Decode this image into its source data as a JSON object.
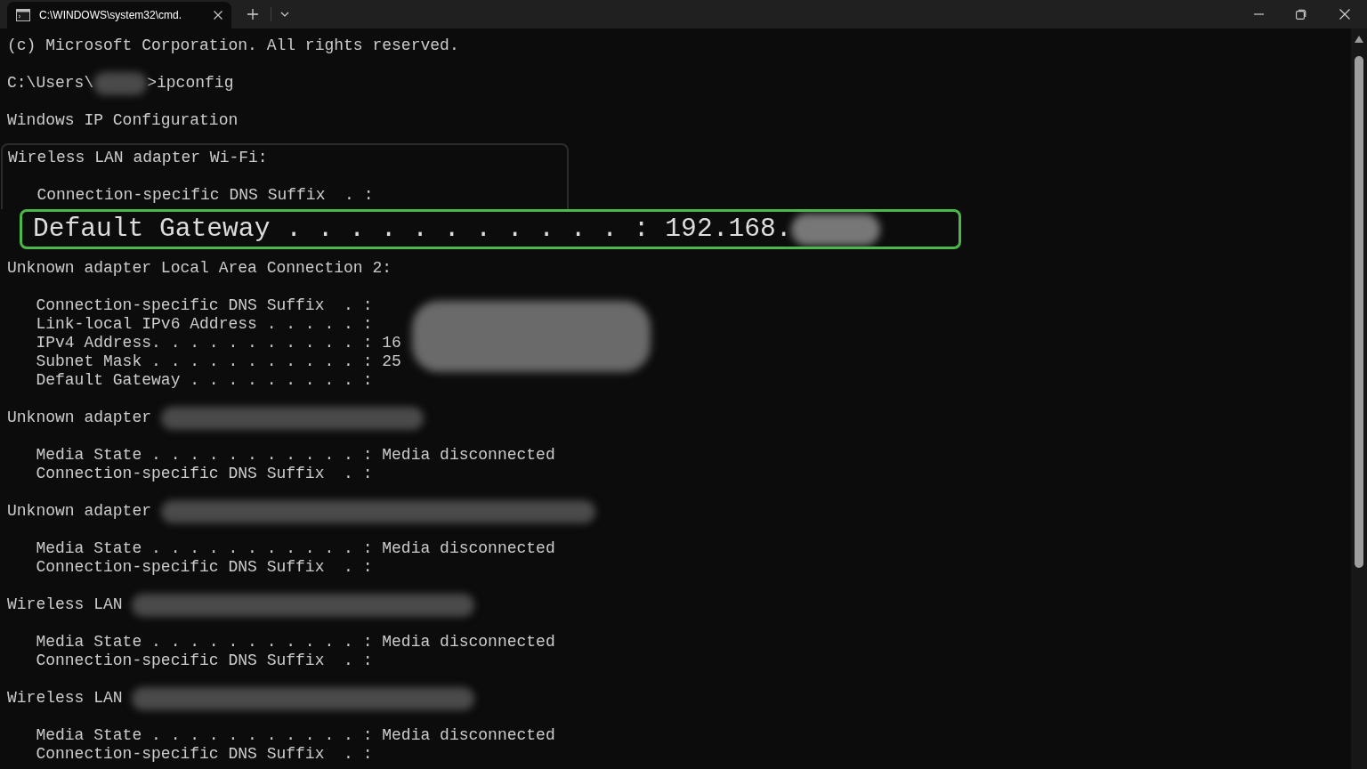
{
  "tabs": [
    {
      "label": "C:\\WINDOWS\\system32\\cmd.",
      "selected": true
    }
  ],
  "console": {
    "intro": [
      {
        "kind": "text",
        "parts": [
          {
            "kind": "text",
            "text": "(c) Microsoft Corporation. All rights reserved."
          }
        ]
      },
      {
        "kind": "blank"
      },
      {
        "kind": "text",
        "parts": [
          {
            "kind": "text",
            "text": "C:\\Users\\"
          },
          {
            "kind": "tinyblur"
          },
          {
            "kind": "text",
            "text": ">ipconfig"
          }
        ]
      },
      {
        "kind": "blank"
      },
      {
        "kind": "text",
        "parts": [
          {
            "kind": "text",
            "text": "Windows IP Configuration"
          }
        ]
      }
    ],
    "framed": [
      {
        "kind": "text",
        "parts": [
          {
            "kind": "text",
            "text": "Wireless LAN adapter Wi-Fi:"
          }
        ]
      },
      {
        "kind": "blank"
      },
      {
        "kind": "text",
        "parts": [
          {
            "kind": "text",
            "text": "   Connection-specific DNS Suffix  . :"
          }
        ]
      }
    ],
    "callout": {
      "parts": [
        {
          "kind": "text",
          "text": "Default Gateway . . . . . . . . . . . : 192.168."
        },
        {
          "kind": "smallblur"
        }
      ]
    },
    "lines": [
      {
        "kind": "text",
        "parts": [
          {
            "kind": "text",
            "text": "Unknown adapter Local Area Connection 2:"
          }
        ]
      },
      {
        "kind": "blank"
      },
      {
        "kind": "text",
        "parts": [
          {
            "kind": "text",
            "text": "   Connection-specific DNS Suffix  . : "
          },
          {
            "kind": "blockblur"
          }
        ]
      },
      {
        "kind": "text",
        "parts": [
          {
            "kind": "text",
            "text": "   Link-local IPv6 Address . . . . . :"
          }
        ]
      },
      {
        "kind": "text",
        "parts": [
          {
            "kind": "text",
            "text": "   IPv4 Address. . . . . . . . . . . : 16"
          }
        ]
      },
      {
        "kind": "text",
        "parts": [
          {
            "kind": "text",
            "text": "   Subnet Mask . . . . . . . . . . . : 25"
          }
        ]
      },
      {
        "kind": "text",
        "parts": [
          {
            "kind": "text",
            "text": "   Default Gateway . . . . . . . . . :"
          }
        ]
      },
      {
        "kind": "blank"
      },
      {
        "kind": "text",
        "parts": [
          {
            "kind": "text",
            "text": "Unknown adapter "
          },
          {
            "kind": "midblur"
          }
        ]
      },
      {
        "kind": "blank"
      },
      {
        "kind": "text",
        "parts": [
          {
            "kind": "text",
            "text": "   Media State . . . . . . . . . . . : Media disconnected"
          }
        ]
      },
      {
        "kind": "text",
        "parts": [
          {
            "kind": "text",
            "text": "   Connection-specific DNS Suffix  . :"
          }
        ]
      },
      {
        "kind": "blank"
      },
      {
        "kind": "text",
        "parts": [
          {
            "kind": "text",
            "text": "Unknown adapter "
          },
          {
            "kind": "longblur"
          }
        ]
      },
      {
        "kind": "blank"
      },
      {
        "kind": "text",
        "parts": [
          {
            "kind": "text",
            "text": "   Media State . . . . . . . . . . . : Media disconnected"
          }
        ]
      },
      {
        "kind": "text",
        "parts": [
          {
            "kind": "text",
            "text": "   Connection-specific DNS Suffix  . :"
          }
        ]
      },
      {
        "kind": "blank"
      },
      {
        "kind": "text",
        "parts": [
          {
            "kind": "text",
            "text": "Wireless LAN "
          },
          {
            "kind": "wideblur"
          }
        ]
      },
      {
        "kind": "blank"
      },
      {
        "kind": "text",
        "parts": [
          {
            "kind": "text",
            "text": "   Media State . . . . . . . . . . . : Media disconnected"
          }
        ]
      },
      {
        "kind": "text",
        "parts": [
          {
            "kind": "text",
            "text": "   Connection-specific DNS Suffix  . :"
          }
        ]
      },
      {
        "kind": "blank"
      },
      {
        "kind": "text",
        "parts": [
          {
            "kind": "text",
            "text": "Wireless LAN "
          },
          {
            "kind": "wideblur"
          }
        ]
      },
      {
        "kind": "blank"
      },
      {
        "kind": "text",
        "parts": [
          {
            "kind": "text",
            "text": "   Media State . . . . . . . . . . . : Media disconnected"
          }
        ]
      },
      {
        "kind": "text",
        "parts": [
          {
            "kind": "text",
            "text": "   Connection-specific DNS Suffix  . :"
          }
        ]
      }
    ]
  }
}
